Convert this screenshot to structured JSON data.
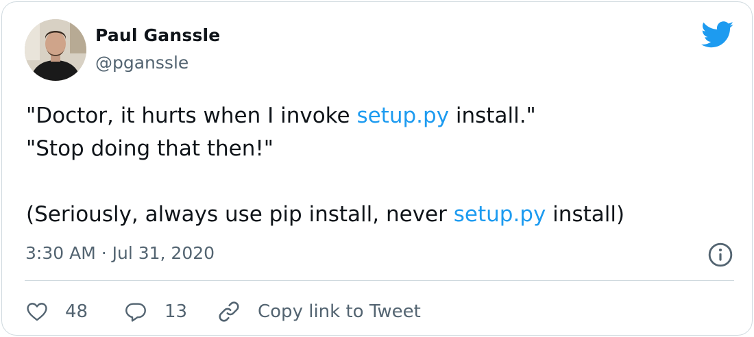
{
  "author": {
    "name": "Paul Ganssle",
    "handle": "@pganssle"
  },
  "tweet": {
    "lines": [
      {
        "pre": "\"Doctor, it hurts when I invoke ",
        "link": "setup.py",
        "post": " install.\""
      },
      {
        "pre": "\"Stop doing that then!\"",
        "link": "",
        "post": ""
      },
      {
        "pre": "",
        "link": "",
        "post": ""
      },
      {
        "pre": "(Seriously, always use pip install, never ",
        "link": "setup.py",
        "post": " install)"
      }
    ],
    "timestamp": "3:30 AM · Jul 31, 2020"
  },
  "actions": {
    "likes": "48",
    "replies": "13",
    "copy_link_label": "Copy link to Tweet"
  },
  "colors": {
    "link": "#1d9bf0",
    "secondary": "#536471",
    "border": "#cfd9de",
    "brand": "#1d9bf0"
  },
  "icons": [
    "twitter-bird-icon",
    "info-icon",
    "heart-icon",
    "reply-icon",
    "link-icon"
  ]
}
